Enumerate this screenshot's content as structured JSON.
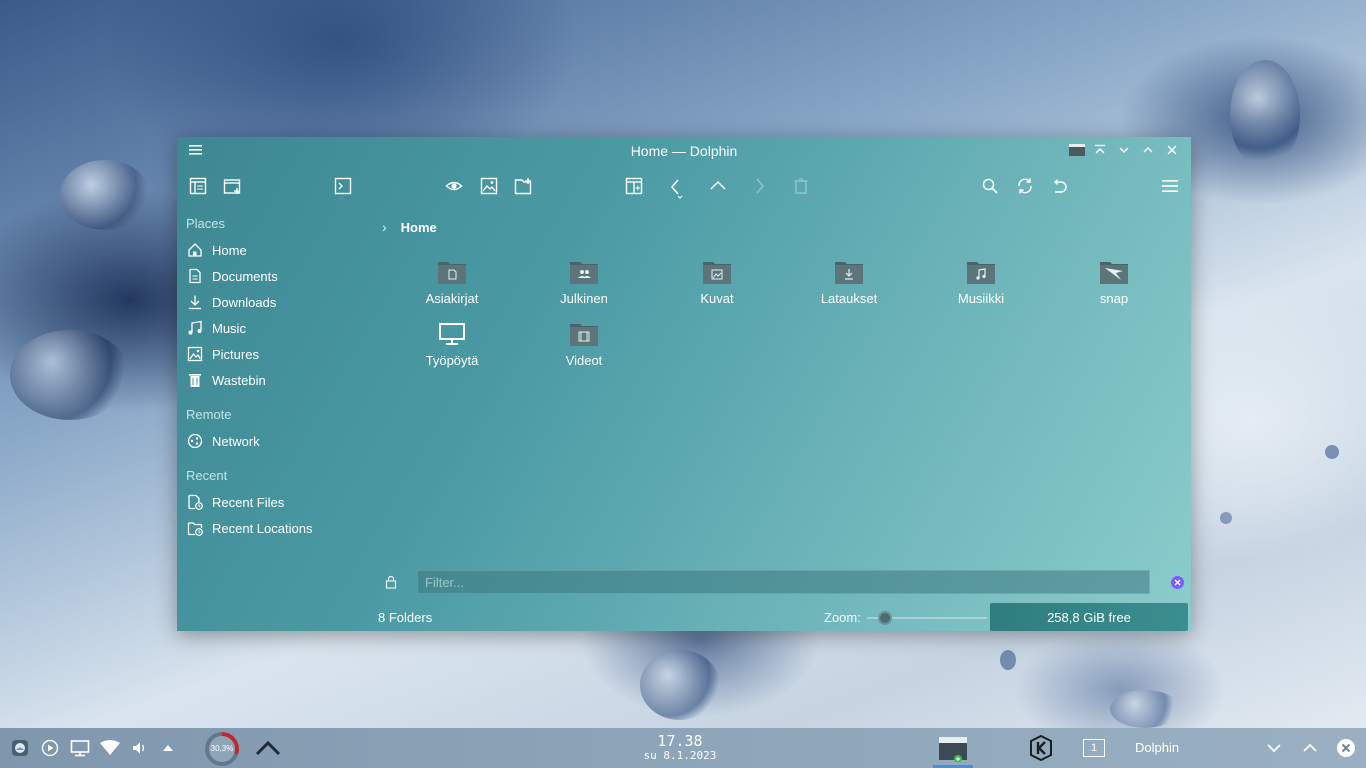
{
  "window": {
    "title": "Home — Dolphin",
    "menu_icon": "hamburger-menu-icon",
    "controls": [
      "keep-above-icon",
      "minimize-icon",
      "maximize-icon",
      "close-icon"
    ]
  },
  "toolbar": {
    "buttons": [
      "view-details-icon",
      "new-tab-icon",
      "terminal-icon",
      "preview-icon",
      "image-icon",
      "new-folder-icon",
      "split-view-icon",
      "back-icon",
      "up-icon",
      "forward-icon",
      "trash-icon",
      "search-icon",
      "refresh-icon",
      "undo-icon",
      "hamburger-menu-icon"
    ]
  },
  "sidebar": {
    "sections": [
      {
        "title": "Places",
        "items": [
          {
            "label": "Home",
            "icon": "home-icon"
          },
          {
            "label": "Documents",
            "icon": "documents-icon"
          },
          {
            "label": "Downloads",
            "icon": "downloads-icon"
          },
          {
            "label": "Music",
            "icon": "music-icon"
          },
          {
            "label": "Pictures",
            "icon": "pictures-icon"
          },
          {
            "label": "Wastebin",
            "icon": "wastebin-icon"
          }
        ]
      },
      {
        "title": "Remote",
        "items": [
          {
            "label": "Network",
            "icon": "network-icon"
          }
        ]
      },
      {
        "title": "Recent",
        "items": [
          {
            "label": "Recent Files",
            "icon": "recent-files-icon"
          },
          {
            "label": "Recent Locations",
            "icon": "recent-locations-icon"
          }
        ]
      }
    ]
  },
  "breadcrumb": {
    "current": "Home"
  },
  "folders": [
    {
      "name": "Asiakirjat",
      "icon": "documents-folder-icon"
    },
    {
      "name": "Julkinen",
      "icon": "public-folder-icon"
    },
    {
      "name": "Kuvat",
      "icon": "pictures-folder-icon"
    },
    {
      "name": "Lataukset",
      "icon": "downloads-folder-icon"
    },
    {
      "name": "Musiikki",
      "icon": "music-folder-icon"
    },
    {
      "name": "snap",
      "icon": "snap-folder-icon"
    },
    {
      "name": "Työpöytä",
      "icon": "desktop-folder-icon"
    },
    {
      "name": "Videot",
      "icon": "videos-folder-icon"
    }
  ],
  "filter": {
    "placeholder": "Filter...",
    "lock_icon": "lock-icon",
    "clear_icon": "clear-icon"
  },
  "status": {
    "summary": "8 Folders",
    "zoom_label": "Zoom:",
    "free_space": "258,8 GiB free",
    "zoom_level": 0.15
  },
  "taskbar": {
    "tray_icons": [
      "app-launcher-icon",
      "media-play-icon",
      "display-icon",
      "wifi-icon",
      "volume-icon",
      "expand-tray-icon"
    ],
    "cpu_usage": "30,3%",
    "clock_time": "17.38",
    "clock_date": "su 8.1.2023",
    "pager_desktop": "1",
    "active_app": "Dolphin",
    "colors": {
      "accent": "#4a9aa4",
      "cpu": "#c0282e"
    }
  }
}
